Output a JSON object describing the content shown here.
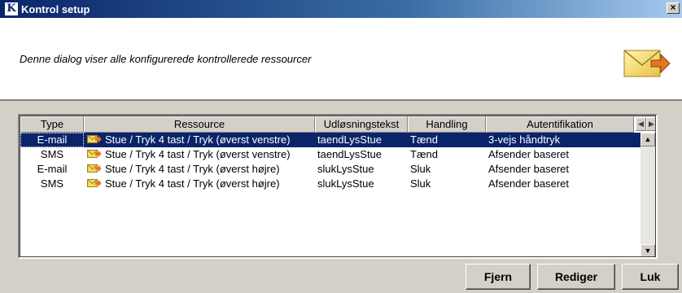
{
  "window": {
    "title": "Kontrol setup",
    "logo_letter": "K",
    "close_symbol": "×"
  },
  "header": {
    "description": "Denne dialog viser alle konfigurerede kontrollerede ressourcer"
  },
  "table": {
    "columns": [
      "Type",
      "Ressource",
      "Udløsningstekst",
      "Handling",
      "Autentifikation"
    ],
    "rows": [
      {
        "type": "E-mail",
        "resource": "Stue / Tryk 4 tast / Tryk (øverst venstre)",
        "trigger": "taendLysStue",
        "action": "Tænd",
        "auth": "3-vejs håndtryk",
        "selected": true
      },
      {
        "type": "SMS",
        "resource": "Stue / Tryk 4 tast / Tryk (øverst venstre)",
        "trigger": "taendLysStue",
        "action": "Tænd",
        "auth": "Afsender baseret",
        "selected": false
      },
      {
        "type": "E-mail",
        "resource": "Stue / Tryk 4 tast / Tryk (øverst højre)",
        "trigger": "slukLysStue",
        "action": "Sluk",
        "auth": "Afsender baseret",
        "selected": false
      },
      {
        "type": "SMS",
        "resource": "Stue / Tryk 4 tast / Tryk (øverst højre)",
        "trigger": "slukLysStue",
        "action": "Sluk",
        "auth": "Afsender baseret",
        "selected": false
      }
    ]
  },
  "buttons": {
    "remove": "Fjern",
    "edit": "Rediger",
    "close": "Luk"
  },
  "colors": {
    "selection": "#0a246a",
    "dialog_bg": "#d4d0c8"
  }
}
